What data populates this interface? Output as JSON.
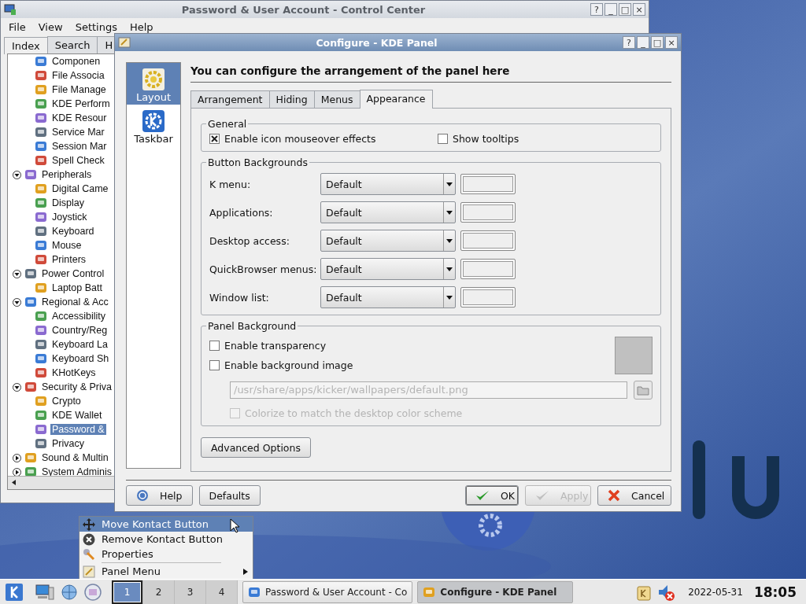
{
  "control_center": {
    "title": "Password & User Account - Control Center",
    "title_buttons": [
      "?",
      "_",
      "□",
      "×"
    ],
    "menu": [
      "File",
      "View",
      "Settings",
      "Help"
    ],
    "tabs": [
      {
        "label": "Index",
        "selected": true
      },
      {
        "label": "Search",
        "selected": false
      },
      {
        "label": "H",
        "selected": false
      }
    ],
    "tree": [
      {
        "children": [
          {
            "label": "Componen",
            "selected": false
          },
          {
            "label": "File Associa",
            "selected": false
          },
          {
            "label": "File Manage",
            "selected": false
          },
          {
            "label": "KDE Perform",
            "selected": false
          },
          {
            "label": "KDE Resour",
            "selected": false
          },
          {
            "label": "Service Mar",
            "selected": false
          },
          {
            "label": "Session Mar",
            "selected": false
          },
          {
            "label": "Spell Check",
            "selected": false
          }
        ]
      },
      {
        "label": "Peripherals",
        "expanded": true,
        "children": [
          {
            "label": "Digital Came",
            "selected": false
          },
          {
            "label": "Display",
            "selected": false
          },
          {
            "label": "Joystick",
            "selected": false
          },
          {
            "label": "Keyboard",
            "selected": false
          },
          {
            "label": "Mouse",
            "selected": false
          },
          {
            "label": "Printers",
            "selected": false
          }
        ]
      },
      {
        "label": "Power Control",
        "expanded": true,
        "children": [
          {
            "label": "Laptop Batt",
            "selected": false
          }
        ]
      },
      {
        "label": "Regional & Acc",
        "expanded": true,
        "children": [
          {
            "label": "Accessibility",
            "selected": false
          },
          {
            "label": "Country/Reg",
            "selected": false
          },
          {
            "label": "Keyboard La",
            "selected": false
          },
          {
            "label": "Keyboard Sh",
            "selected": false
          },
          {
            "label": "KHotKeys",
            "selected": false
          }
        ]
      },
      {
        "label": "Security & Priva",
        "expanded": true,
        "children": [
          {
            "label": "Crypto",
            "selected": false
          },
          {
            "label": "KDE Wallet",
            "selected": false
          },
          {
            "label": "Password &",
            "selected": true
          },
          {
            "label": "Privacy",
            "selected": false
          }
        ]
      },
      {
        "label": "Sound & Multin",
        "expanded": false
      },
      {
        "label": "System Adminis",
        "expanded": false
      }
    ]
  },
  "dialog": {
    "title": "Configure - KDE Panel",
    "title_buttons": [
      "?",
      "_",
      "□",
      "×"
    ],
    "sidebar": [
      {
        "label": "Layout",
        "selected": true
      },
      {
        "label": "Taskbar",
        "selected": false
      }
    ],
    "heading": "You can configure the arrangement of the panel here",
    "tabs": [
      {
        "label": "Arrangement",
        "selected": false
      },
      {
        "label": "Hiding",
        "selected": false
      },
      {
        "label": "Menus",
        "selected": false
      },
      {
        "label": "Appearance",
        "selected": true
      }
    ],
    "general": {
      "title": "General",
      "options": [
        {
          "label": "Enable icon mouseover effects",
          "checked": true
        },
        {
          "label": "Show tooltips",
          "checked": false
        }
      ]
    },
    "button_backgrounds": {
      "title": "Button Backgrounds",
      "rows": [
        {
          "label": "K menu:",
          "value": "Default"
        },
        {
          "label": "Applications:",
          "value": "Default"
        },
        {
          "label": "Desktop access:",
          "value": "Default"
        },
        {
          "label": "QuickBrowser menus:",
          "value": "Default"
        },
        {
          "label": "Window list:",
          "value": "Default"
        }
      ]
    },
    "panel_background": {
      "title": "Panel Background",
      "options": [
        {
          "label": "Enable transparency",
          "checked": false
        },
        {
          "label": "Enable background image",
          "checked": false
        }
      ],
      "image_path": {
        "value": "/usr/share/apps/kicker/wallpapers/default.png",
        "disabled": true
      },
      "colorize": {
        "label": "Colorize to match the desktop color scheme",
        "checked": false,
        "disabled": true
      }
    },
    "advanced_button": "Advanced Options",
    "buttons": [
      {
        "kind": "help",
        "label": "Help",
        "disabled": false
      },
      {
        "kind": "plain",
        "label": "Defaults",
        "disabled": false
      },
      {
        "kind": "ok",
        "label": "OK",
        "disabled": false
      },
      {
        "kind": "apply",
        "label": "Apply",
        "disabled": true
      },
      {
        "kind": "cancel",
        "label": "Cancel",
        "disabled": false
      }
    ]
  },
  "context_menu": [
    {
      "label": "Move Kontact Button",
      "selected": true,
      "submenu": false
    },
    {
      "label": "Remove Kontact Button",
      "selected": false,
      "submenu": false
    },
    {
      "label": "Properties",
      "selected": false,
      "submenu": false
    },
    {
      "label": "Panel Menu",
      "selected": false,
      "submenu": true
    }
  ],
  "taskbar": {
    "desktops": [
      {
        "label": "1",
        "selected": true
      },
      {
        "label": "2",
        "selected": false
      },
      {
        "label": "3",
        "selected": false
      },
      {
        "label": "4",
        "selected": false
      }
    ],
    "tasks": [
      {
        "label": "Password & User Account - Co",
        "selected": false
      },
      {
        "label": "Configure - KDE Panel",
        "selected": true
      }
    ],
    "date": "2022-05-31",
    "time": "18:05"
  }
}
